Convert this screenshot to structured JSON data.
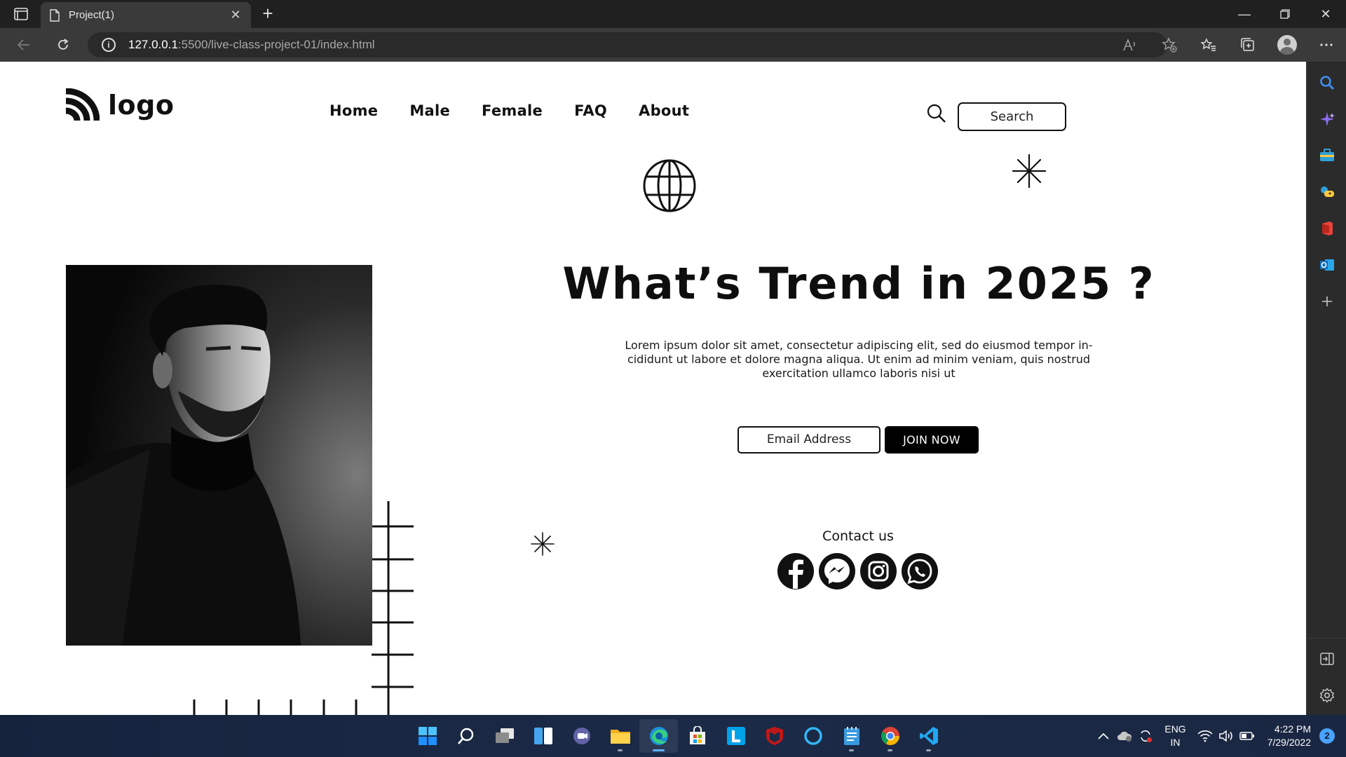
{
  "browser": {
    "tab_title": "Project(1)",
    "url_host": "127.0.0.1",
    "url_path": ":5500/live-class-project-01/index.html"
  },
  "site": {
    "logo_text": "logo",
    "nav": [
      "Home",
      "Male",
      "Female",
      "FAQ",
      "About"
    ],
    "search_placeholder": "Search",
    "headline": "What’s Trend in 2025 ?",
    "lede": "Lorem ipsum dolor sit amet, consectetur adipiscing elit, sed do eiusmod tempor in- cididunt ut labore et dolore magna aliqua. Ut enim ad minim veniam, quis nostrud exercitation ullamco laboris nisi ut",
    "email_placeholder": "Email Address",
    "join_label": "JOIN NOW",
    "contact_label": "Contact us",
    "socials": [
      "facebook-icon",
      "messenger-icon",
      "instagram-icon",
      "whatsapp-icon"
    ]
  },
  "taskbar": {
    "apps": [
      "start-icon",
      "search-icon",
      "task-view-icon",
      "widgets-icon",
      "teams-chat-icon",
      "file-explorer-icon",
      "edge-icon",
      "store-icon",
      "l-app-icon",
      "mcafee-icon",
      "cortana-icon",
      "notepad-icon",
      "chrome-icon",
      "vscode-icon"
    ],
    "lang_top": "ENG",
    "lang_bottom": "IN",
    "time": "4:22 PM",
    "date": "7/29/2022",
    "notifications": "2"
  },
  "colors": {
    "accent_blue": "#4aa3ff",
    "page_bg": "#ffffff",
    "chrome_bg": "#202020"
  }
}
